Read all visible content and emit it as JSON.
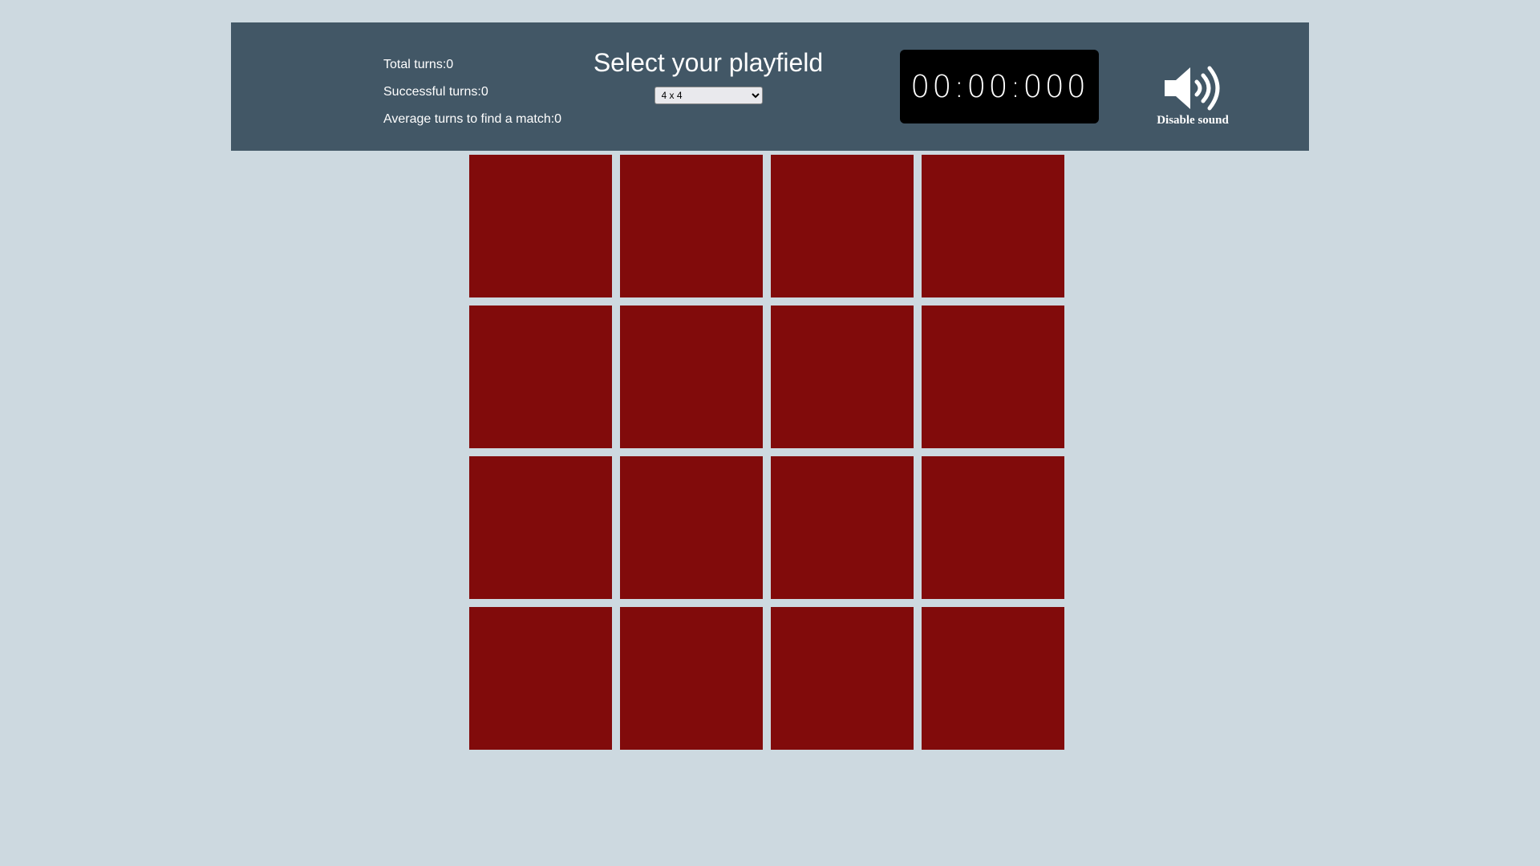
{
  "stats": {
    "total_turns": "Total turns:0",
    "successful_turns": "Successful turns:0",
    "average_turns": "Average turns to find a match:0"
  },
  "playfield": {
    "title": "Select your playfield",
    "selected_option": "4 x 4"
  },
  "timer": {
    "display": "00:00:000"
  },
  "sound": {
    "icon": "speaker-icon",
    "label": "Disable sound"
  },
  "board": {
    "rows": 4,
    "columns": 4,
    "card_color": "#810b0b"
  },
  "colors": {
    "background": "#cdd9e0",
    "header": "#425766",
    "timer_bg": "#000000"
  }
}
